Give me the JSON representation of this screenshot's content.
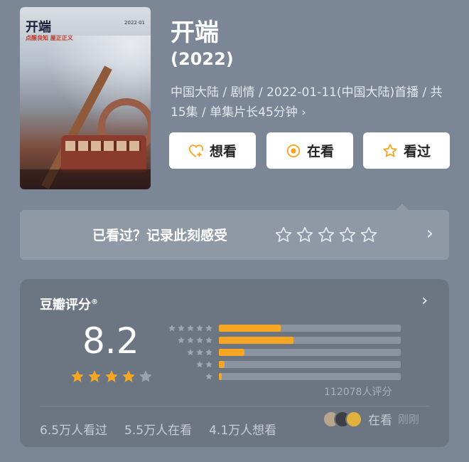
{
  "poster": {
    "title_art": "开端",
    "tagline": "点醒良知 厘正正义",
    "year_badge": "2022·01"
  },
  "show": {
    "title": "开端",
    "year": "(2022)",
    "meta": "中国大陆 / 剧情 / 2022-01-11(中国大陆)首播 / 共15集 / 单集片长45分钟"
  },
  "actions": {
    "want_label": "想看",
    "watching_label": "在看",
    "watched_label": "看过"
  },
  "record": {
    "prompt": "已看过？记录此刻感受"
  },
  "rating": {
    "label": "豆瓣评分",
    "label_mark": "®",
    "score": "8.2",
    "score_value": 8.2,
    "distribution_pct": [
      34,
      41,
      14,
      3,
      1
    ],
    "count_text": "112078人评分",
    "accent": "#f6a623"
  },
  "stats": {
    "watched": "6.5万人看过",
    "watching": "5.5万人在看",
    "want": "4.1万人想看"
  },
  "activity": {
    "label": "在看",
    "time": "刚刚"
  }
}
